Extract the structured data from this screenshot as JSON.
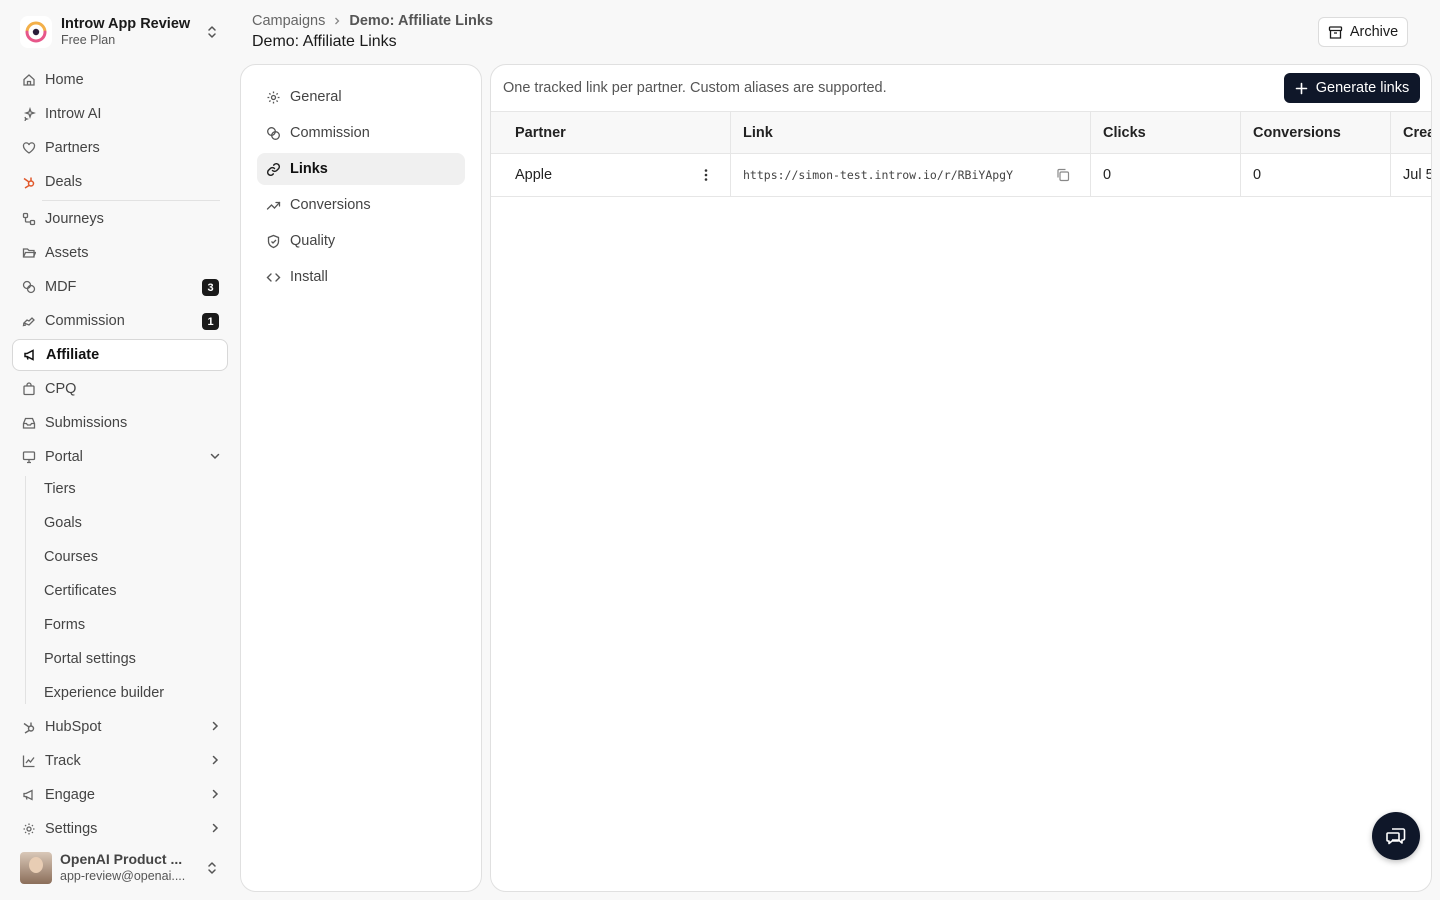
{
  "workspace": {
    "name": "Introw App Review",
    "plan": "Free Plan"
  },
  "sidebar": {
    "items": [
      {
        "label": "Home"
      },
      {
        "label": "Introw AI"
      },
      {
        "label": "Partners"
      },
      {
        "label": "Deals"
      },
      {
        "label": "Journeys"
      },
      {
        "label": "Assets"
      },
      {
        "label": "MDF",
        "badge": "3"
      },
      {
        "label": "Commission",
        "badge": "1"
      },
      {
        "label": "Affiliate"
      },
      {
        "label": "CPQ"
      },
      {
        "label": "Submissions"
      },
      {
        "label": "Portal"
      },
      {
        "label": "HubSpot"
      },
      {
        "label": "Track"
      },
      {
        "label": "Engage"
      },
      {
        "label": "Settings"
      }
    ],
    "portal_sub": [
      "Tiers",
      "Goals",
      "Courses",
      "Certificates",
      "Forms",
      "Portal settings",
      "Experience builder"
    ]
  },
  "user": {
    "name": "OpenAI Product ...",
    "email": "app-review@openai...."
  },
  "breadcrumb": {
    "parent": "Campaigns",
    "current": "Demo: Affiliate Links"
  },
  "page": {
    "title": "Demo: Affiliate Links",
    "archive_label": "Archive"
  },
  "subnav": [
    "General",
    "Commission",
    "Links",
    "Conversions",
    "Quality",
    "Install"
  ],
  "main": {
    "hint": "One tracked link per partner. Custom aliases are supported.",
    "generate_label": "Generate links",
    "columns": [
      "Partner",
      "Link",
      "Clicks",
      "Conversions",
      "Crea"
    ],
    "rows": [
      {
        "partner": "Apple",
        "link": "https://simon-test.introw.io/r/RBiYApgY",
        "clicks": "0",
        "conversions": "0",
        "created": "Jul 5"
      }
    ]
  },
  "colors": {
    "primary": "#0f1729",
    "accent": "#e0582b"
  }
}
